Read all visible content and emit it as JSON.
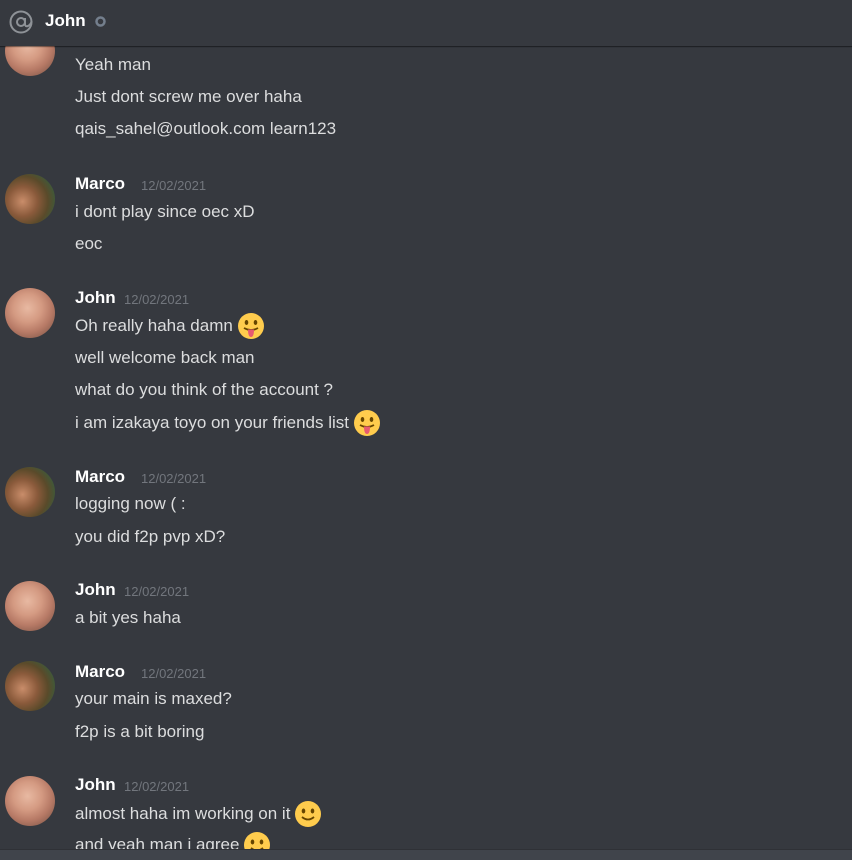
{
  "header": {
    "title": "John",
    "icons": {
      "at": "at-icon",
      "status": "status-dot-icon"
    }
  },
  "colors": {
    "background": "#36393f",
    "author": "#ffffff",
    "text": "#dcddde",
    "timestamp": "#72767d"
  },
  "messages": [
    {
      "lines": [
        "Yeah man",
        "Just dont screw me over haha",
        "qais_sahel@outlook.com learn123"
      ]
    },
    {
      "author": "Marco",
      "timestamp": "12/02/2021",
      "lines": [
        "i dont play since oec xD",
        "eoc"
      ]
    },
    {
      "author": "John",
      "timestamp": "12/02/2021",
      "lines": [
        "Oh really haha damn",
        "well welcome back man",
        "what do you think of the account ?",
        "i am izakaya toyo on your friends list"
      ]
    },
    {
      "author": "Marco",
      "timestamp": "12/02/2021",
      "lines": [
        "logging now ( :",
        "you did f2p pvp xD?"
      ]
    },
    {
      "author": "John",
      "timestamp": "12/02/2021",
      "lines": [
        "a bit yes haha"
      ]
    },
    {
      "author": "Marco",
      "timestamp": "12/02/2021",
      "lines": [
        "your main is maxed?",
        "f2p is a bit boring"
      ]
    },
    {
      "author": "John",
      "timestamp": "12/02/2021",
      "lines": [
        "almost haha im working on it",
        "and yeah man i agree"
      ]
    }
  ]
}
